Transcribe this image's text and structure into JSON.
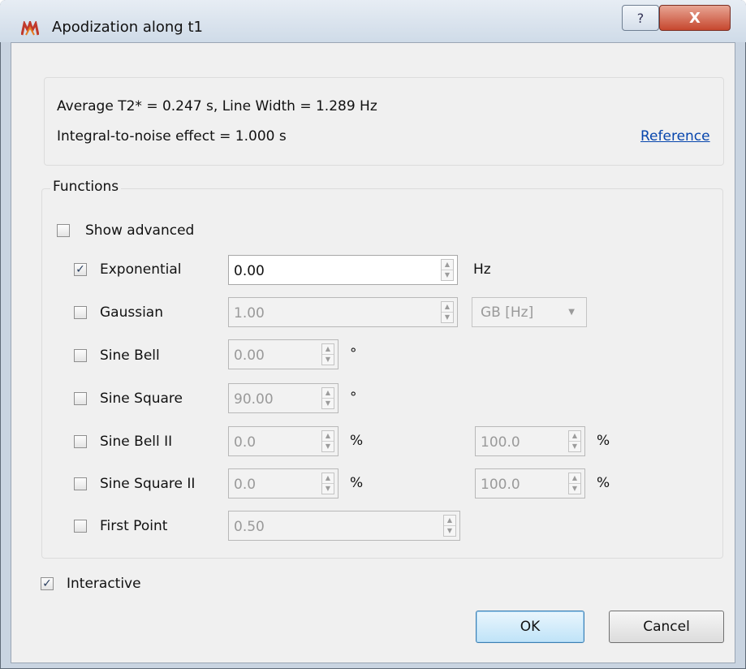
{
  "window": {
    "title": "Apodization along t1",
    "help_label": "?",
    "close_label": "X"
  },
  "info": {
    "line1": "Average T2* = 0.247 s, Line Width = 1.289 Hz",
    "line2": "Integral-to-noise effect = 1.000 s",
    "reference_link": "Reference"
  },
  "functions": {
    "group_title": "Functions",
    "show_advanced": {
      "label": "Show advanced",
      "checked": false
    },
    "rows": [
      {
        "label": "Exponential",
        "checked": true,
        "value": "0.00",
        "unit": "Hz"
      },
      {
        "label": "Gaussian",
        "checked": false,
        "value": "1.00",
        "select_value": "GB [Hz]"
      },
      {
        "label": "Sine Bell",
        "checked": false,
        "value": "0.00",
        "unit": "°"
      },
      {
        "label": "Sine Square",
        "checked": false,
        "value": "90.00",
        "unit": "°"
      },
      {
        "label": "Sine Bell II",
        "checked": false,
        "value": "0.0",
        "unit": "%",
        "value2": "100.0",
        "unit2": "%"
      },
      {
        "label": "Sine Square II",
        "checked": false,
        "value": "0.0",
        "unit": "%",
        "value2": "100.0",
        "unit2": "%"
      },
      {
        "label": "First Point",
        "checked": false,
        "value": "0.50"
      }
    ]
  },
  "interactive": {
    "label": "Interactive",
    "checked": true
  },
  "buttons": {
    "ok": "OK",
    "cancel": "Cancel"
  },
  "colors": {
    "link": "#0645ad",
    "close_button": "#c6472e",
    "dialog_bg": "#f0f0f0"
  },
  "check_glyph": "✓"
}
